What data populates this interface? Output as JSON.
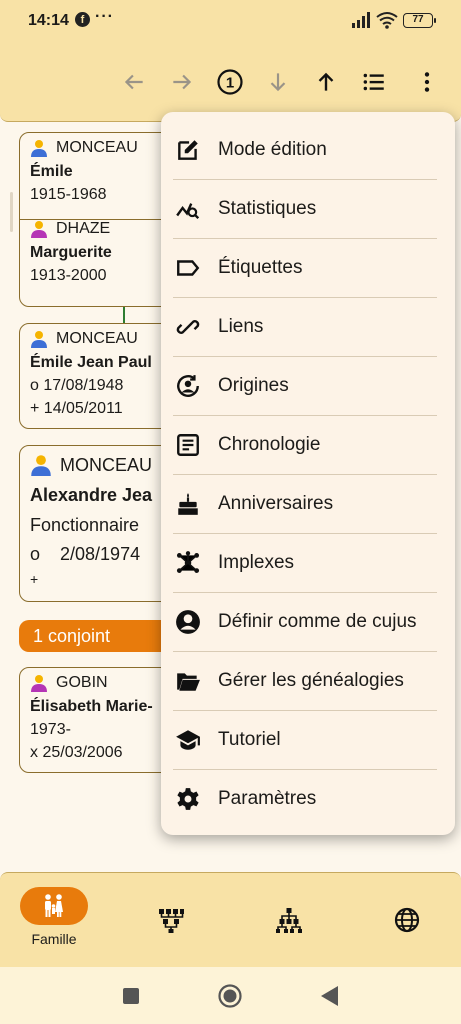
{
  "status": {
    "time": "14:14",
    "fb": "f",
    "dots": "···",
    "battery": "77"
  },
  "toolbar": {
    "icons": [
      "arrow-back-icon",
      "arrow-forward-icon",
      "number-one-circle-icon",
      "arrow-down-icon",
      "arrow-up-icon",
      "list-icon",
      "more-vert-icon"
    ],
    "page_badge": "1"
  },
  "cards": {
    "c1": {
      "surname": "MONCEAU",
      "given": "Émile",
      "dates": "1915-1968",
      "sex_color": "#3d6fd6"
    },
    "c2": {
      "surname": "DHAZE",
      "given": "Marguerite",
      "dates": "1913-2000",
      "sex_color": "#b535b5"
    },
    "c3": {
      "surname": "MONCEAU",
      "given": "Émile Jean Paul",
      "birth": "o 17/08/1948",
      "death": "+ 14/05/2011"
    },
    "c4": {
      "surname": "MONCEAU",
      "given": "Alexandre Jea",
      "occupation": "Fonctionnaire",
      "birth": "o    2/08/1974",
      "death": "+"
    },
    "c5": {
      "surname": "GOBIN",
      "given": "Élisabeth Marie-",
      "birth": "1973-",
      "marriage": "x 25/03/2006"
    }
  },
  "conjoint_label": "1 conjoint",
  "menu": {
    "items": [
      {
        "label": "Mode édition",
        "icon": "edit-icon"
      },
      {
        "label": "Statistiques",
        "icon": "stats-icon"
      },
      {
        "label": "Étiquettes",
        "icon": "label-icon"
      },
      {
        "label": "Liens",
        "icon": "link-icon"
      },
      {
        "label": "Origines",
        "icon": "origins-icon"
      },
      {
        "label": "Chronologie",
        "icon": "chronology-icon"
      },
      {
        "label": "Anniversaires",
        "icon": "cake-icon"
      },
      {
        "label": "Implexes",
        "icon": "implex-icon"
      },
      {
        "label": "Définir comme de cujus",
        "icon": "account-circle-icon"
      },
      {
        "label": "Gérer les généalogies",
        "icon": "folder-open-icon"
      },
      {
        "label": "Tutoriel",
        "icon": "school-icon"
      },
      {
        "label": "Paramètres",
        "icon": "settings-icon"
      }
    ]
  },
  "bottom_nav": {
    "famille_label": "Famille"
  },
  "colors": {
    "accent": "#e87b0c",
    "bar": "#f8e2a6",
    "male": "#3d6fd6",
    "female": "#b535b5",
    "link": "#2e7d32"
  }
}
